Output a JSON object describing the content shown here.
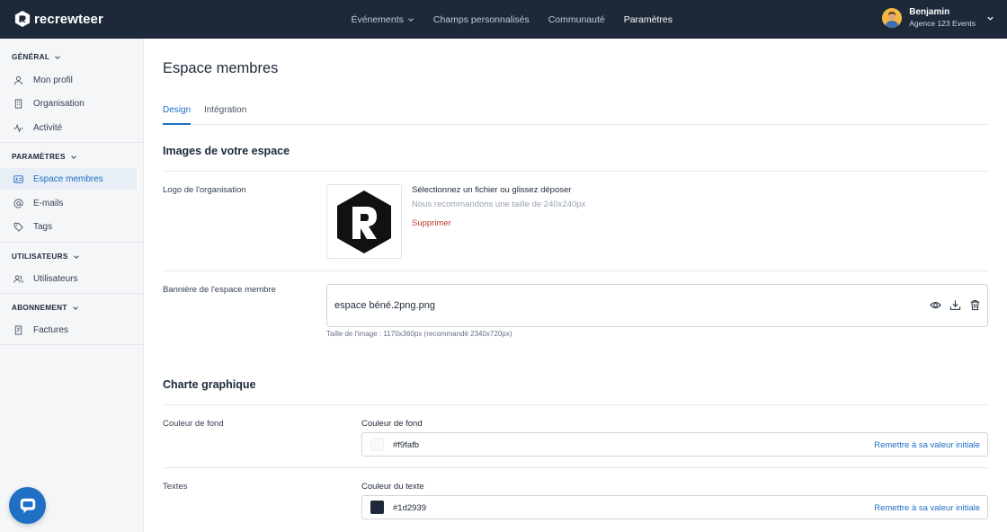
{
  "header": {
    "brand": "recrewteer",
    "nav": [
      {
        "label": "Événements"
      },
      {
        "label": "Champs personnalisés"
      },
      {
        "label": "Communauté"
      },
      {
        "label": "Paramètres"
      }
    ],
    "user": {
      "name": "Benjamin",
      "org": "Agence 123 Events"
    }
  },
  "sidebar": {
    "sections": [
      {
        "title": "GÉNÉRAL",
        "items": [
          {
            "label": "Mon profil"
          },
          {
            "label": "Organisation"
          },
          {
            "label": "Activité"
          }
        ]
      },
      {
        "title": "PARAMÈTRES",
        "items": [
          {
            "label": "Espace membres"
          },
          {
            "label": "E-mails"
          },
          {
            "label": "Tags"
          }
        ]
      },
      {
        "title": "UTILISATEURS",
        "items": [
          {
            "label": "Utilisateurs"
          }
        ]
      },
      {
        "title": "ABONNEMENT",
        "items": [
          {
            "label": "Factures"
          }
        ]
      }
    ]
  },
  "main": {
    "title": "Espace membres",
    "tabs": [
      {
        "label": "Design"
      },
      {
        "label": "Intégration"
      }
    ],
    "images_section": {
      "title": "Images de votre espace",
      "logo": {
        "label": "Logo de l'organisation",
        "upload": "Sélectionnez un fichier ou glissez déposer",
        "hint": "Nous recommandons une taille de 240x240px",
        "delete": "Supprimer"
      },
      "banner": {
        "label": "Bannière de l'espace membre",
        "file": "espace béné.2png.png",
        "hint": "Taille de l'image : 1170x360px (recommandé 2340x720px)"
      }
    },
    "charte_section": {
      "title": "Charte graphique",
      "background": {
        "label": "Couleur de fond",
        "field_label": "Couleur de fond",
        "value": "#f9fafb",
        "reset": "Remettre à sa valeur initiale"
      },
      "texts": {
        "label": "Textes",
        "field_label": "Couleur du texte",
        "value": "#1d2939",
        "reset": "Remettre à sa valeur initiale"
      }
    }
  },
  "colors": {
    "topbar": "#1d2939",
    "accent": "#1f6fc5",
    "danger": "#c0392b",
    "sidebar_bg": "#f4f6f8"
  },
  "icons": [
    "brand-logo-icon",
    "chevron-down-icon",
    "user-icon",
    "building-icon",
    "activity-icon",
    "id-card-icon",
    "at-icon",
    "tag-icon",
    "users-icon",
    "receipt-icon",
    "chat-icon",
    "eye-icon",
    "download-icon",
    "trash-icon"
  ]
}
